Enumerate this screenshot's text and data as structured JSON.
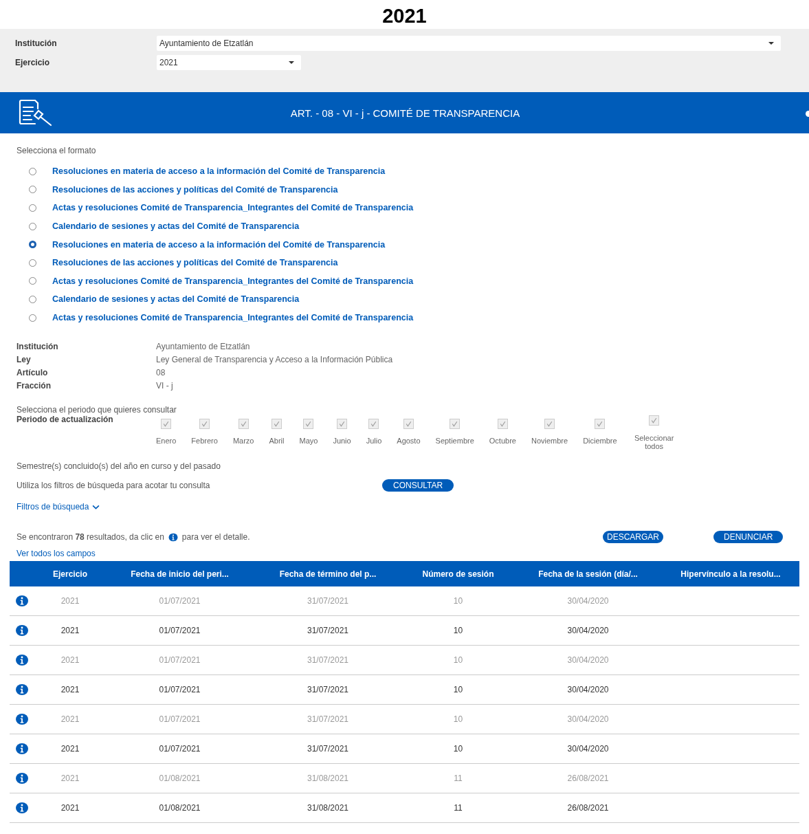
{
  "page_title": "2021",
  "filters": [
    {
      "label": "Institución",
      "value": "Ayuntamiento de Etzatlán",
      "kind": "wide"
    },
    {
      "label": "Ejercicio",
      "value": "2021",
      "kind": "narrow"
    }
  ],
  "banner": {
    "title": "ART. - 08 - VI - j - COMITÉ DE TRANSPARENCIA"
  },
  "format_prompt": "Selecciona el formato",
  "formats": [
    {
      "label": "Resoluciones en materia de acceso a la información del Comité de Transparencia",
      "selected": false
    },
    {
      "label": "Resoluciones de las acciones y políticas del Comité de Transparencia",
      "selected": false
    },
    {
      "label": "Actas y resoluciones Comité de Transparencia_Integrantes del Comité de Transparencia",
      "selected": false
    },
    {
      "label": "Calendario de sesiones y actas del Comité de Transparencia",
      "selected": false
    },
    {
      "label": "Resoluciones en materia de acceso a la información del Comité de Transparencia",
      "selected": true
    },
    {
      "label": "Resoluciones de las acciones y políticas del Comité de Transparencia",
      "selected": false
    },
    {
      "label": "Actas y resoluciones Comité de Transparencia_Integrantes del Comité de Transparencia",
      "selected": false
    },
    {
      "label": "Calendario de sesiones y actas del Comité de Transparencia",
      "selected": false
    },
    {
      "label": "Actas y resoluciones Comité de Transparencia_Integrantes del Comité de Transparencia",
      "selected": false
    }
  ],
  "details": [
    {
      "label": "Institución",
      "value": "Ayuntamiento de Etzatlán"
    },
    {
      "label": "Ley",
      "value": "Ley General de Transparencia y Acceso a la Información Pública"
    },
    {
      "label": "Artículo",
      "value": "08"
    },
    {
      "label": "Fracción",
      "value": "VI - j"
    }
  ],
  "period_prompt": "Selecciona el periodo que quieres consultar",
  "period_label": "Periodo de actualización",
  "months": [
    {
      "label": "Enero",
      "checked": true
    },
    {
      "label": "Febrero",
      "checked": true
    },
    {
      "label": "Marzo",
      "checked": true
    },
    {
      "label": "Abril",
      "checked": true
    },
    {
      "label": "Mayo",
      "checked": true
    },
    {
      "label": "Junio",
      "checked": true
    },
    {
      "label": "Julio",
      "checked": true
    },
    {
      "label": "Agosto",
      "checked": true
    },
    {
      "label": "Septiembre",
      "checked": true
    },
    {
      "label": "Octubre",
      "checked": true
    },
    {
      "label": "Noviembre",
      "checked": true
    },
    {
      "label": "Diciembre",
      "checked": true
    },
    {
      "label": "Seleccionar todos",
      "checked": true
    }
  ],
  "semester_note": "Semestre(s) concluido(s) del año en curso y del pasado",
  "filter_hint": "Utiliza los filtros de búsqueda para acotar tu consulta",
  "consult_button": "CONSULTAR",
  "search_filters_link": "Filtros de búsqueda",
  "results_before": "Se encontraron **78** resultados, da clic en",
  "results_after": "para ver el detalle.",
  "download_button": "DESCARGAR",
  "report_button": "DENUNCIAR",
  "all_fields_link": "Ver todos los campos",
  "table": {
    "columns": [
      "Ejercicio",
      "Fecha de inicio del peri...",
      "Fecha de término del p...",
      "Número de sesión",
      "Fecha de la sesión (día/...",
      "Hipervínculo a la resolu..."
    ],
    "rows": [
      {
        "muted": true,
        "cells": [
          "2021",
          "01/07/2021",
          "31/07/2021",
          "10",
          "30/04/2020"
        ]
      },
      {
        "muted": false,
        "cells": [
          "2021",
          "01/07/2021",
          "31/07/2021",
          "10",
          "30/04/2020"
        ]
      },
      {
        "muted": true,
        "cells": [
          "2021",
          "01/07/2021",
          "31/07/2021",
          "10",
          "30/04/2020"
        ]
      },
      {
        "muted": false,
        "cells": [
          "2021",
          "01/07/2021",
          "31/07/2021",
          "10",
          "30/04/2020"
        ]
      },
      {
        "muted": true,
        "cells": [
          "2021",
          "01/07/2021",
          "31/07/2021",
          "10",
          "30/04/2020"
        ]
      },
      {
        "muted": false,
        "cells": [
          "2021",
          "01/07/2021",
          "31/07/2021",
          "10",
          "30/04/2020"
        ]
      },
      {
        "muted": true,
        "cells": [
          "2021",
          "01/08/2021",
          "31/08/2021",
          "11",
          "26/08/2021"
        ]
      },
      {
        "muted": false,
        "cells": [
          "2021",
          "01/08/2021",
          "31/08/2021",
          "11",
          "26/08/2021"
        ]
      }
    ]
  }
}
